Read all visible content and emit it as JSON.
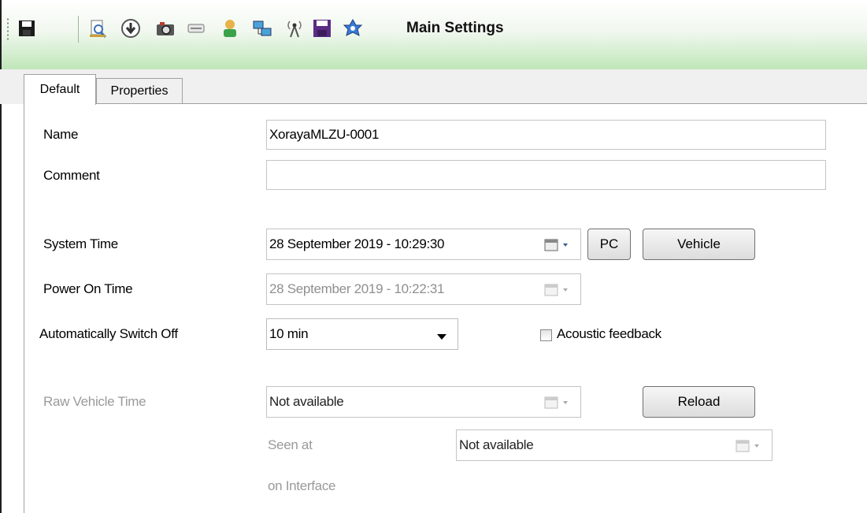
{
  "toolbar": {
    "title": "Main Settings",
    "icons": [
      "save-icon",
      "print-preview-icon",
      "download-icon",
      "camera-icon",
      "card-icon",
      "user-icon",
      "network-icon",
      "antenna-icon",
      "disk-icon",
      "settings-icon"
    ]
  },
  "tabs": [
    {
      "label": "Default",
      "active": true
    },
    {
      "label": "Properties",
      "active": false
    }
  ],
  "form": {
    "name_label": "Name",
    "name_value": "XorayaMLZU-0001",
    "comment_label": "Comment",
    "comment_value": "",
    "system_time_label": "System Time",
    "system_time_value": "28 September 2019 - 10:29:30",
    "pc_button": "PC",
    "vehicle_button": "Vehicle",
    "power_on_time_label": "Power On Time",
    "power_on_time_value": "28 September 2019 - 10:22:31",
    "auto_switch_label": "Automatically Switch Off",
    "auto_switch_value": "10 min",
    "acoustic_label": "Acoustic feedback",
    "acoustic_checked": false,
    "raw_vehicle_time_label": "Raw Vehicle Time",
    "raw_vehicle_time_value": "Not available",
    "reload_button": "Reload",
    "seen_at_label": "Seen at",
    "seen_at_value": "Not available",
    "on_interface_label": "on Interface"
  }
}
